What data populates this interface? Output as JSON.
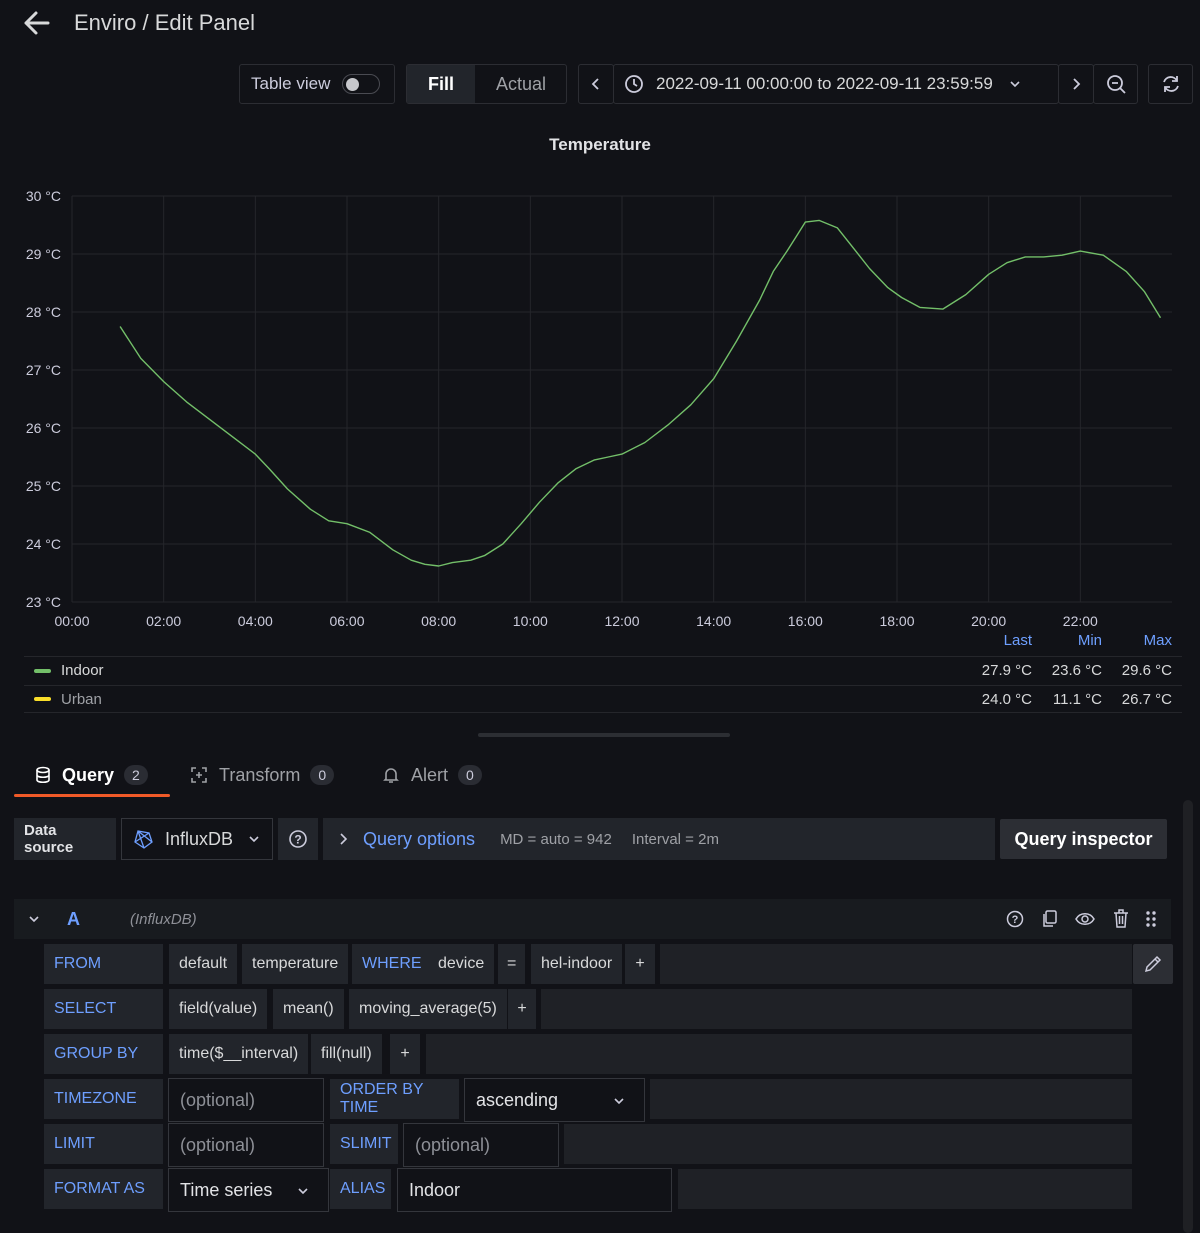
{
  "header": {
    "title": "Enviro / Edit Panel"
  },
  "toolbar": {
    "table_view_label": "Table view",
    "fill_label": "Fill",
    "actual_label": "Actual",
    "time_range": "2022-09-11 00:00:00 to 2022-09-11 23:59:59"
  },
  "chart_data": {
    "type": "line",
    "title": "Temperature",
    "y_ticks": [
      "30 °C",
      "29 °C",
      "28 °C",
      "27 °C",
      "26 °C",
      "25 °C",
      "24 °C",
      "23 °C"
    ],
    "x_ticks": [
      "00:00",
      "02:00",
      "04:00",
      "06:00",
      "08:00",
      "10:00",
      "12:00",
      "14:00",
      "16:00",
      "18:00",
      "20:00",
      "22:00"
    ],
    "ylim": [
      23,
      30
    ],
    "xlim": [
      0,
      24
    ],
    "grid": true,
    "series": [
      {
        "name": "Indoor",
        "color": "#73bf69",
        "x": [
          1.05,
          1.5,
          2.0,
          2.5,
          3.0,
          3.5,
          4.0,
          4.3,
          4.7,
          5.2,
          5.6,
          6.0,
          6.5,
          7.0,
          7.4,
          7.7,
          8.0,
          8.3,
          8.7,
          9.0,
          9.4,
          9.8,
          10.2,
          10.6,
          11.0,
          11.4,
          11.7,
          12.0,
          12.5,
          13.0,
          13.5,
          14.0,
          14.5,
          15.0,
          15.3,
          15.6,
          15.8,
          16.0,
          16.3,
          16.7,
          17.0,
          17.4,
          17.8,
          18.1,
          18.5,
          19.0,
          19.5,
          20.0,
          20.4,
          20.8,
          21.2,
          21.6,
          22.0,
          22.5,
          23.0,
          23.4,
          23.75
        ],
        "y": [
          27.75,
          27.2,
          26.8,
          26.45,
          26.15,
          25.85,
          25.55,
          25.3,
          24.95,
          24.6,
          24.4,
          24.35,
          24.2,
          23.9,
          23.72,
          23.65,
          23.62,
          23.68,
          23.72,
          23.8,
          24.0,
          24.35,
          24.72,
          25.05,
          25.3,
          25.45,
          25.5,
          25.55,
          25.75,
          26.05,
          26.4,
          26.85,
          27.5,
          28.2,
          28.7,
          29.05,
          29.3,
          29.55,
          29.58,
          29.45,
          29.15,
          28.75,
          28.42,
          28.25,
          28.08,
          28.05,
          28.3,
          28.65,
          28.85,
          28.95,
          28.95,
          28.98,
          29.05,
          28.98,
          28.7,
          28.35,
          27.9
        ]
      },
      {
        "name": "Urban",
        "color": "#fade2a",
        "x": [],
        "y": []
      }
    ],
    "legend": {
      "columns": [
        "Last",
        "Min",
        "Max"
      ],
      "rows": [
        {
          "name": "Indoor",
          "color": "#73bf69",
          "last": "27.9 °C",
          "min": "23.6 °C",
          "max": "29.6 °C"
        },
        {
          "name": "Urban",
          "color": "#fade2a",
          "last": "24.0 °C",
          "min": "11.1 °C",
          "max": "26.7 °C"
        }
      ]
    }
  },
  "tabs": [
    {
      "label": "Query",
      "count": "2"
    },
    {
      "label": "Transform",
      "count": "0"
    },
    {
      "label": "Alert",
      "count": "0"
    }
  ],
  "datasource": {
    "label": "Data source",
    "name": "InfluxDB",
    "query_options": "Query options",
    "md": "MD = auto = 942",
    "interval": "Interval = 2m",
    "inspector": "Query inspector"
  },
  "query": {
    "ref": "A",
    "source": "(InfluxDB)",
    "from_kw": "FROM",
    "from": [
      "default",
      "temperature"
    ],
    "where_kw": "WHERE",
    "where": [
      "device",
      "=",
      "hel-indoor"
    ],
    "select_kw": "SELECT",
    "select": [
      "field(value)",
      "mean()",
      "moving_average(5)"
    ],
    "group_kw": "GROUP BY",
    "group": [
      "time($__interval)",
      "fill(null)"
    ],
    "plus": "+",
    "timezone_kw": "TIMEZONE",
    "timezone_placeholder": "(optional)",
    "order_kw": "ORDER BY TIME",
    "order_value": "ascending",
    "limit_kw": "LIMIT",
    "limit_placeholder": "(optional)",
    "slimit_kw": "SLIMIT",
    "slimit_placeholder": "(optional)",
    "format_kw": "FORMAT AS",
    "format_value": "Time series",
    "alias_kw": "ALIAS",
    "alias_value": "Indoor"
  }
}
